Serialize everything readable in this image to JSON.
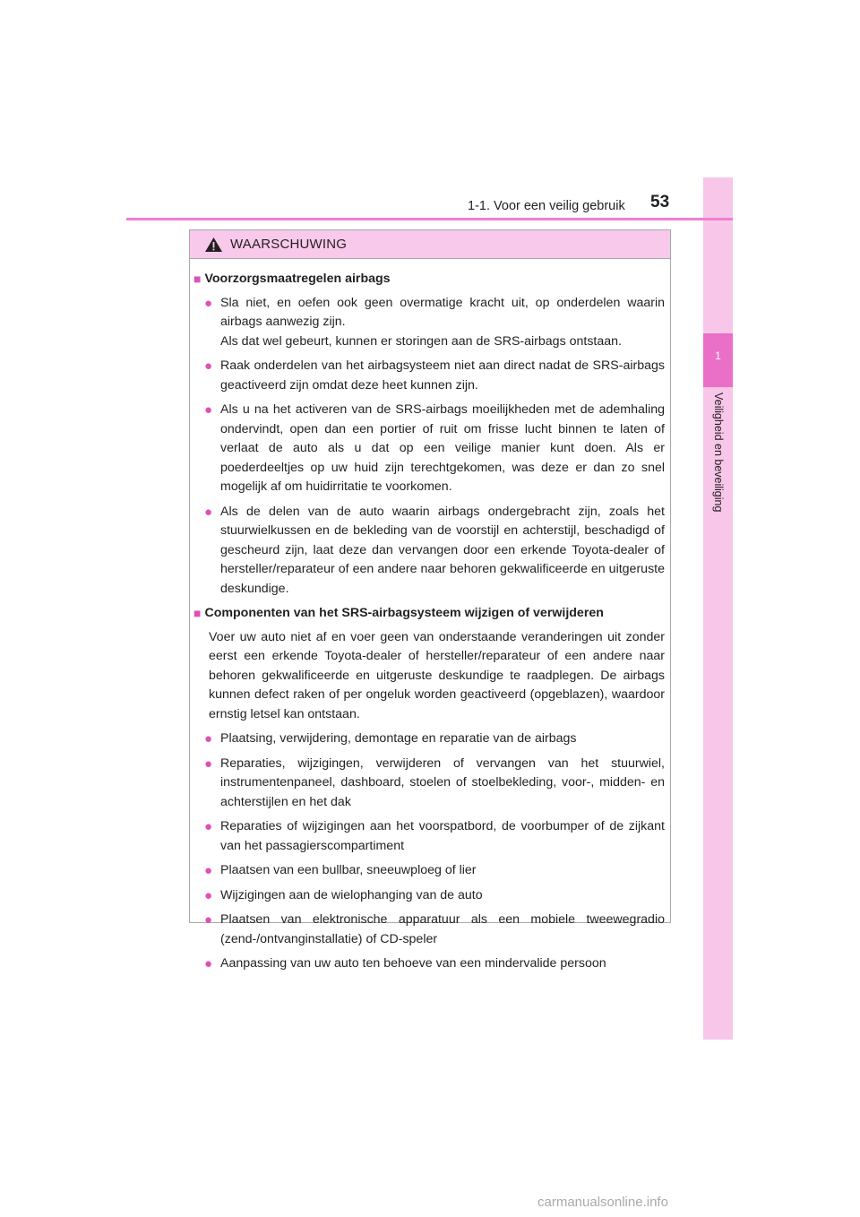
{
  "header": {
    "page_number": "53",
    "section_title": "1-1. Voor een veilig gebruik"
  },
  "sidebar": {
    "chapter_number": "1",
    "chapter_title": "Veiligheid en beveiliging"
  },
  "warning": {
    "icon": "warning-triangle-icon",
    "label": "WAARSCHUWING",
    "section1": {
      "title": "Voorzorgsmaatregelen airbags",
      "bullets": [
        "Sla niet, en oefen ook geen overmatige kracht uit, op onderdelen waarin airbags aanwezig zijn.\nAls dat wel gebeurt, kunnen er storingen aan de SRS-airbags ontstaan.",
        "Raak onderdelen van het airbagsysteem niet aan direct nadat de SRS-airbags geactiveerd zijn omdat deze heet kunnen zijn.",
        "Als u na het activeren van de SRS-airbags moeilijkheden met de ademhaling ondervindt, open dan een portier of ruit om frisse lucht binnen te laten of verlaat de auto als u dat op een veilige manier kunt doen. Als er poederdeeltjes op uw huid zijn terechtgekomen, was deze er dan zo snel mogelijk af om huidirritatie te voorkomen.",
        "Als de delen van de auto waarin airbags ondergebracht zijn, zoals het stuurwielkussen en de bekleding van de voorstijl en achterstijl, beschadigd of gescheurd zijn, laat deze dan vervangen door een erkende Toyota-dealer of hersteller/reparateur of een andere naar behoren gekwalificeerde en uitgeruste deskundige."
      ]
    },
    "section2": {
      "title": "Componenten van het SRS-airbagsysteem wijzigen of verwijderen",
      "intro": "Voer uw auto niet af en voer geen van onderstaande veranderingen uit zonder eerst een erkende Toyota-dealer of hersteller/reparateur of een andere naar behoren gekwalificeerde en uitgeruste deskundige te raadplegen. De airbags kunnen defect raken of per ongeluk worden geactiveerd (opgeblazen), waardoor ernstig letsel kan ontstaan.",
      "bullets": [
        "Plaatsing, verwijdering, demontage en reparatie van de airbags",
        "Reparaties, wijzigingen, verwijderen of vervangen van het stuurwiel, instrumentenpaneel, dashboard, stoelen of stoelbekleding, voor-, midden- en achterstijlen en het dak",
        "Reparaties of wijzigingen aan het voorspatbord, de voorbumper of de zijkant van het passagierscompartiment",
        "Plaatsen van een bullbar, sneeuwploeg of lier",
        "Wijzigingen aan de wielophanging van de auto",
        "Plaatsen van elektronische apparatuur als een mobiele tweewegradio (zend-/ontvanginstallatie) of CD-speler",
        "Aanpassing van uw auto ten behoeve van een mindervalide persoon"
      ]
    }
  },
  "footer": {
    "watermark": "carmanualsonline.info"
  }
}
